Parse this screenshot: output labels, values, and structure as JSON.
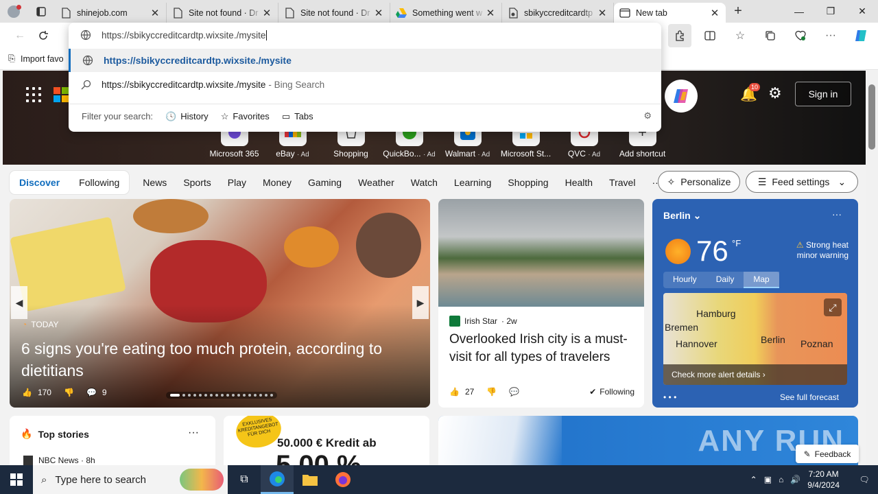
{
  "tabs": [
    {
      "title": "shinejob.com",
      "icon": "page-icon"
    },
    {
      "title": "Site not found · Dr",
      "icon": "page-icon"
    },
    {
      "title": "Site not found · Dr",
      "icon": "page-icon"
    },
    {
      "title": "Something went w",
      "icon": "google-drive-icon"
    },
    {
      "title": "sbikyccreditcardtp",
      "icon": "wix-icon"
    },
    {
      "title": "New tab",
      "icon": "newtab-icon",
      "active": true
    }
  ],
  "address": {
    "value": "https://sbikyccreditcardtp.wixsite./mysite",
    "suggestion_url": "https://sbikyccreditcardtp.wixsite./mysite",
    "suggestion_search": "https://sbikyccreditcardtp.wixsite./mysite",
    "suggestion_search_suffix": "- Bing Search",
    "filter_label": "Filter your search:",
    "filters": [
      "History",
      "Favorites",
      "Tabs"
    ]
  },
  "favbar": {
    "import_label": "Import favo"
  },
  "hero": {
    "signin": "Sign in",
    "notification_count": "10",
    "tiles": [
      {
        "label": "Microsoft 365",
        "ad": ""
      },
      {
        "label": "eBay",
        "ad": "· Ad"
      },
      {
        "label": "Shopping",
        "ad": ""
      },
      {
        "label": "QuickBo...",
        "ad": "· Ad"
      },
      {
        "label": "Walmart",
        "ad": "· Ad"
      },
      {
        "label": "Microsoft St...",
        "ad": ""
      },
      {
        "label": "QVC",
        "ad": "· Ad"
      },
      {
        "label": "Add shortcut",
        "ad": ""
      }
    ]
  },
  "feednav": {
    "discover": "Discover",
    "following": "Following",
    "categories": [
      "News",
      "Sports",
      "Play",
      "Money",
      "Gaming",
      "Weather",
      "Watch",
      "Learning",
      "Shopping",
      "Health",
      "Travel",
      "···"
    ],
    "personalize": "Personalize",
    "feed_settings": "Feed settings"
  },
  "bigcard": {
    "source": "TODAY",
    "headline": "6 signs you're eating too much protein, according to dietitians",
    "likes": "170",
    "comments": "9"
  },
  "card2": {
    "source": "Irish Star",
    "age": "· 2w",
    "headline": "Overlooked Irish city is a must-visit for all types of travelers",
    "likes": "27",
    "following": "Following"
  },
  "weather": {
    "city": "Berlin",
    "temp": "76",
    "unit": "°F",
    "warning": "Strong heat minor warning",
    "tabs": [
      "Hourly",
      "Daily",
      "Map"
    ],
    "map_labels": [
      "Hamburg",
      "Bremen",
      "Hannover",
      "Berlin",
      "Poznan"
    ],
    "alert": "Check more alert details",
    "forecast": "See full forecast"
  },
  "topstories": {
    "title": "Top stories",
    "source": "NBC News · 8h"
  },
  "ad": {
    "badge": "EXKLUSIVES KREDITANGEBOT FÜR DICH",
    "text": "50.000 € Kredit ab",
    "big": "5,00 %"
  },
  "banner": {
    "watermark": "ANY RUN"
  },
  "feedback": "Feedback",
  "taskbar": {
    "search": "Type here to search",
    "time": "7:20 AM",
    "date": "9/4/2024"
  }
}
